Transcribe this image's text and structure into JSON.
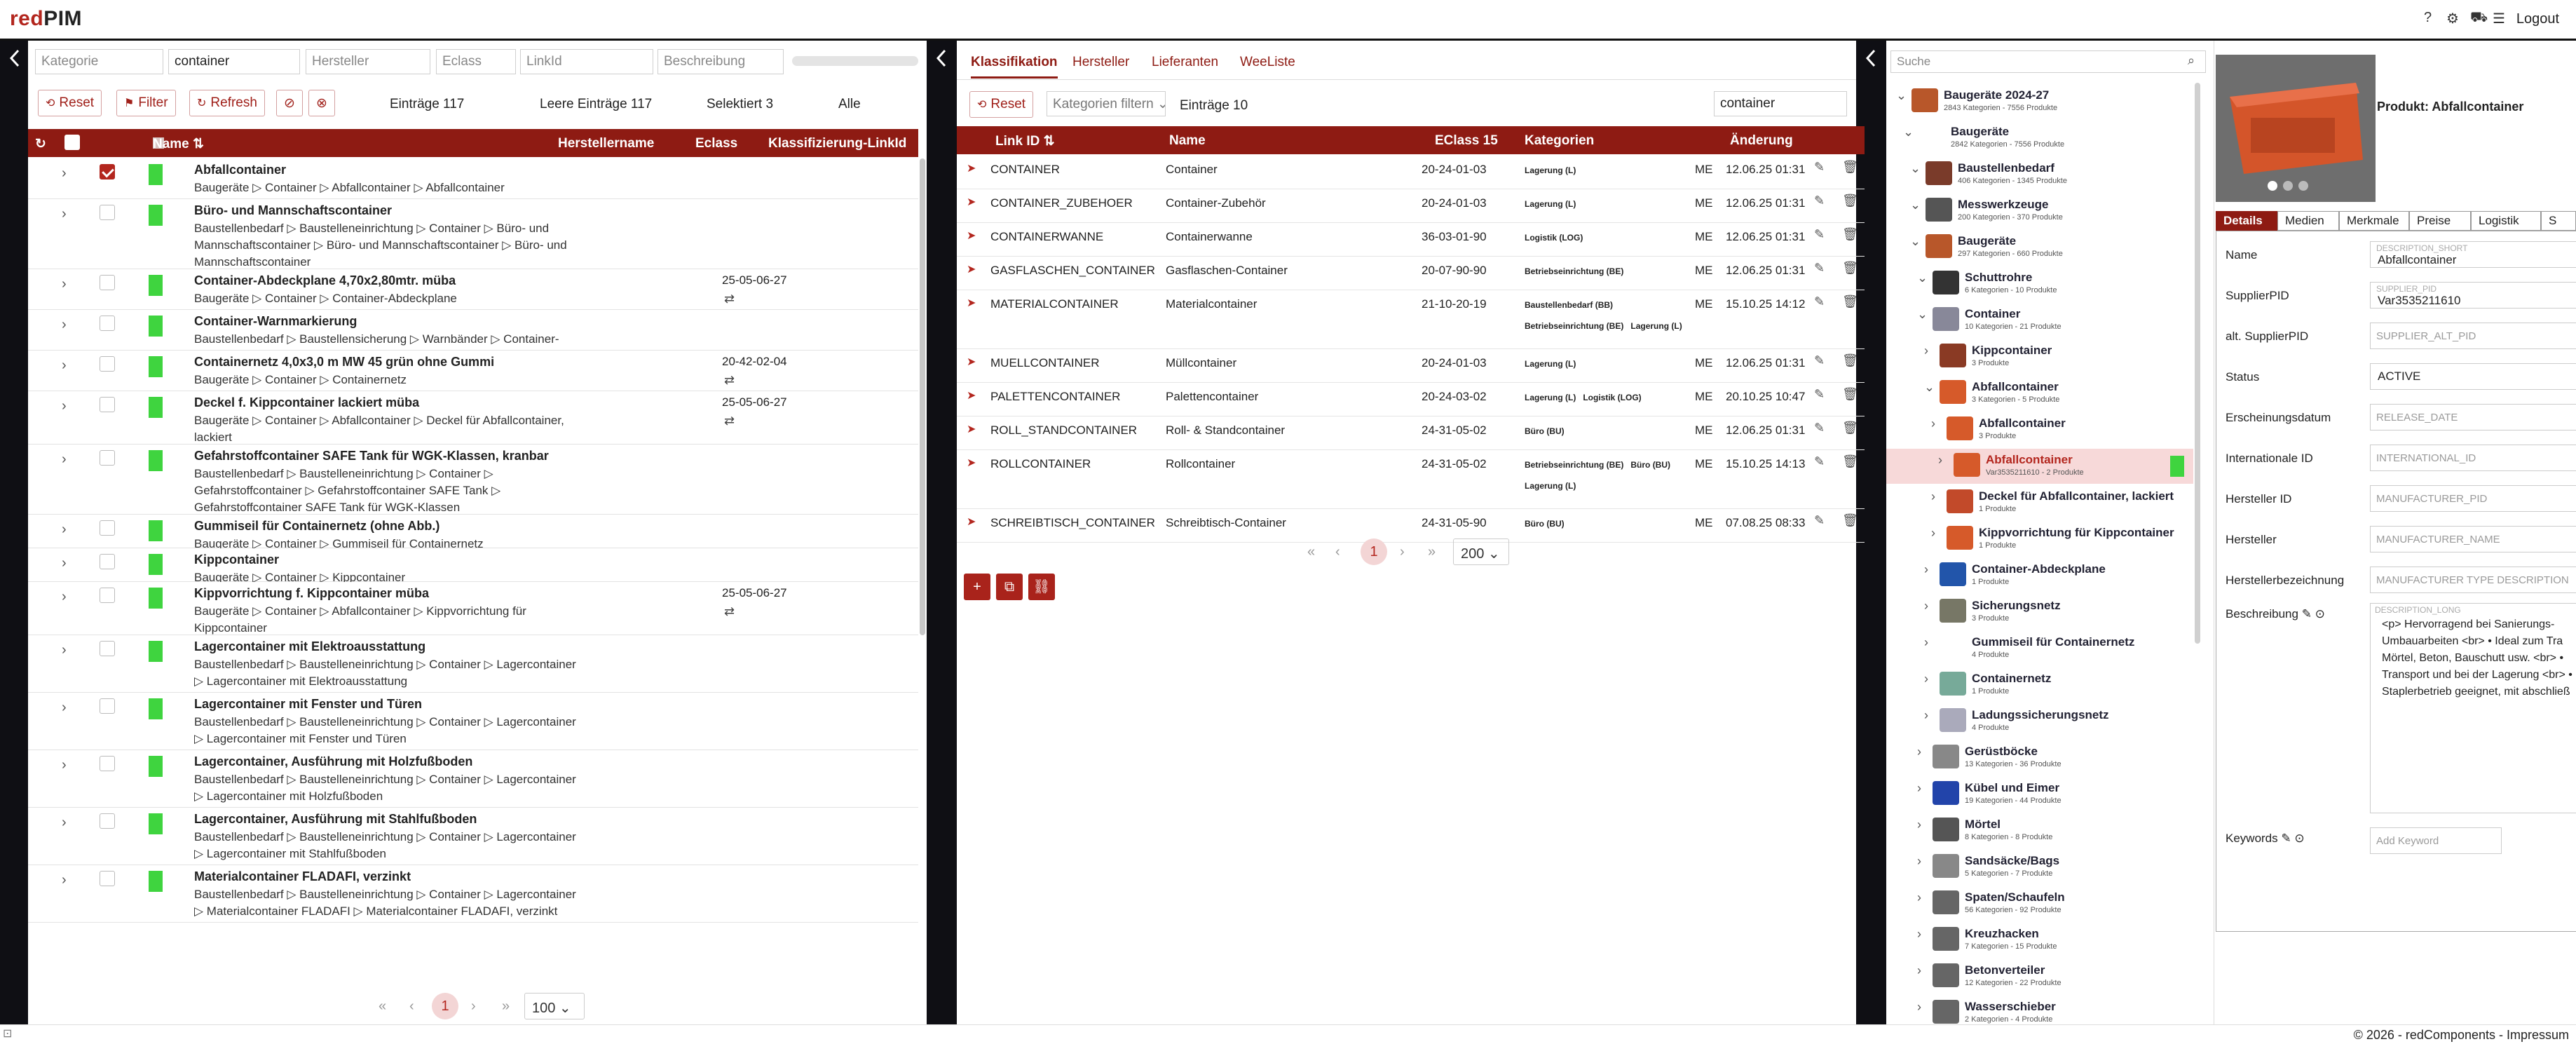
{
  "app": {
    "logo": "redPIM",
    "logo_red": "red",
    "logo_rest": "PIM",
    "logout": "Logout",
    "footer": "© 2026 - redComponents - Impressum"
  },
  "left": {
    "filters": [
      {
        "ph": "Kategorie"
      },
      {
        "val": "container"
      },
      {
        "ph": "Hersteller"
      },
      {
        "ph": "Eclass"
      },
      {
        "ph": "LinkId"
      },
      {
        "ph": "Beschreibung"
      }
    ],
    "buttons": {
      "reset": "Reset",
      "filter": "Filter",
      "refresh": "Refresh"
    },
    "stats": {
      "entries": "Einträge 117",
      "empty": "Leere Einträge 117",
      "selected": "Selektiert 3",
      "all": "Alle"
    },
    "headers": {
      "name": "Name ⇅",
      "manufacturer": "Herstellername",
      "eclass": "Eclass",
      "link": "Klassifizierung-LinkId"
    },
    "rows": [
      {
        "name": "Abfallcontainer",
        "path": "Baugeräte ▷ Container ▷ Abfallcontainer ▷ Abfallcontainer",
        "eclass": "",
        "checked": true
      },
      {
        "name": "Büro- und Mannschaftscontainer",
        "path": "Baustellenbedarf ▷ Baustelleneinrichtung ▷ Container ▷ Büro- und Mannschaftscontainer ▷ Büro- und Mannschaftscontainer ▷ Büro- und Mannschaftscontainer",
        "eclass": ""
      },
      {
        "name": "Container-Abdeckplane 4,70x2,80mtr. müba",
        "path": "Baugeräte ▷ Container ▷ Container-Abdeckplane",
        "eclass": "25-05-06-27"
      },
      {
        "name": "Container-Warnmarkierung",
        "path": "Baustellenbedarf ▷ Baustellensicherung ▷ Warnbänder ▷ Container-Warnmarkierung",
        "eclass": ""
      },
      {
        "name": "Containernetz 4,0x3,0 m MW 45 grün ohne Gummi",
        "path": "Baugeräte ▷ Container ▷ Containernetz",
        "eclass": "20-42-02-04"
      },
      {
        "name": "Deckel f. Kippcontainer lackiert müba",
        "path": "Baugeräte ▷ Container ▷ Abfallcontainer ▷ Deckel für Abfallcontainer, lackiert",
        "eclass": "25-05-06-27"
      },
      {
        "name": "Gefahrstoffcontainer SAFE Tank für WGK-Klassen, kranbar",
        "path": "Baustellenbedarf ▷ Baustelleneinrichtung ▷ Container ▷ Gefahrstoffcontainer ▷ Gefahrstoffcontainer SAFE Tank ▷ Gefahrstoffcontainer SAFE Tank für WGK-Klassen",
        "eclass": ""
      },
      {
        "name": "Gummiseil für Containernetz (ohne Abb.)",
        "path": "Baugeräte ▷ Container ▷ Gummiseil für Containernetz",
        "eclass": ""
      },
      {
        "name": "Kippcontainer",
        "path": "Baugeräte ▷ Container ▷ Kippcontainer",
        "eclass": ""
      },
      {
        "name": "Kippvorrichtung f. Kippcontainer müba",
        "path": "Baugeräte ▷ Container ▷ Abfallcontainer ▷ Kippvorrichtung für Kippcontainer",
        "eclass": "25-05-06-27"
      },
      {
        "name": "Lagercontainer mit Elektroausstattung",
        "path": "Baustellenbedarf ▷ Baustelleneinrichtung ▷ Container ▷ Lagercontainer ▷ Lagercontainer mit Elektroausstattung",
        "eclass": ""
      },
      {
        "name": "Lagercontainer mit Fenster und Türen",
        "path": "Baustellenbedarf ▷ Baustelleneinrichtung ▷ Container ▷ Lagercontainer ▷ Lagercontainer mit Fenster und Türen",
        "eclass": ""
      },
      {
        "name": "Lagercontainer, Ausführung mit Holzfußboden",
        "path": "Baustellenbedarf ▷ Baustelleneinrichtung ▷ Container ▷ Lagercontainer ▷ Lagercontainer mit Holzfußboden",
        "eclass": ""
      },
      {
        "name": "Lagercontainer, Ausführung mit Stahlfußboden",
        "path": "Baustellenbedarf ▷ Baustelleneinrichtung ▷ Container ▷ Lagercontainer ▷ Lagercontainer mit Stahlfußboden",
        "eclass": ""
      },
      {
        "name": "Materialcontainer FLADAFI, verzinkt",
        "path": "Baustellenbedarf ▷ Baustelleneinrichtung ▷ Container ▷ Lagercontainer ▷ Materialcontainer FLADAFI ▷ Materialcontainer FLADAFI, verzinkt",
        "eclass": ""
      }
    ],
    "pager": {
      "page": "1",
      "size": "100"
    }
  },
  "middle": {
    "tabs": [
      "Klassifikation",
      "Hersteller",
      "Lieferanten",
      "WeeListe"
    ],
    "reset": "Reset",
    "cat_filter": "Kategorien filtern",
    "entries": "Einträge 10",
    "search": "container",
    "headers": {
      "link": "Link ID ⇅",
      "name": "Name",
      "eclass": "EClass 15",
      "cats": "Kategorien",
      "change": "Änderung"
    },
    "rows": [
      {
        "id": "CONTAINER",
        "name": "Container",
        "ecl": "20-24-01-03",
        "cats": [
          "Lagerung (L)"
        ],
        "unit": "ME",
        "date": "12.06.25 01:31"
      },
      {
        "id": "CONTAINER_ZUBEHOER",
        "name": "Container-Zubehör",
        "ecl": "20-24-01-03",
        "cats": [
          "Lagerung (L)"
        ],
        "unit": "ME",
        "date": "12.06.25 01:31"
      },
      {
        "id": "CONTAINERWANNE",
        "name": "Containerwanne",
        "ecl": "36-03-01-90",
        "cats": [
          "Logistik (LOG)"
        ],
        "unit": "ME",
        "date": "12.06.25 01:31"
      },
      {
        "id": "GASFLASCHEN_CONTAINER",
        "name": "Gasflaschen-Container",
        "ecl": "20-07-90-90",
        "cats": [
          "Betriebseinrichtung (BE)"
        ],
        "unit": "ME",
        "date": "12.06.25 01:31"
      },
      {
        "id": "MATERIALCONTAINER",
        "name": "Materialcontainer",
        "ecl": "21-10-20-19",
        "cats": [
          "Baustellenbedarf (BB)",
          "Betriebseinrichtung (BE)",
          "Lagerung (L)"
        ],
        "unit": "ME",
        "date": "15.10.25 14:12"
      },
      {
        "id": "MUELLCONTAINER",
        "name": "Müllcontainer",
        "ecl": "20-24-01-03",
        "cats": [
          "Lagerung (L)"
        ],
        "unit": "ME",
        "date": "12.06.25 01:31"
      },
      {
        "id": "PALETTENCONTAINER",
        "name": "Palettencontainer",
        "ecl": "20-24-03-02",
        "cats": [
          "Lagerung (L)",
          "Logistik (LOG)"
        ],
        "unit": "ME",
        "date": "20.10.25 10:47"
      },
      {
        "id": "ROLL_STANDCONTAINER",
        "name": "Roll- & Standcontainer",
        "ecl": "24-31-05-02",
        "cats": [
          "Büro (BU)"
        ],
        "unit": "ME",
        "date": "12.06.25 01:31"
      },
      {
        "id": "ROLLCONTAINER",
        "name": "Rollcontainer",
        "ecl": "24-31-05-02",
        "cats": [
          "Betriebseinrichtung (BE)",
          "Büro (BU)",
          "Lagerung (L)"
        ],
        "unit": "ME",
        "date": "15.10.25 14:13"
      },
      {
        "id": "SCHREIBTISCH_CONTAINER",
        "name": "Schreibtisch-Container",
        "ecl": "24-31-05-90",
        "cats": [
          "Büro (BU)"
        ],
        "unit": "ME",
        "date": "07.08.25 08:33"
      }
    ],
    "pager": {
      "page": "1",
      "size": "200"
    }
  },
  "tree": {
    "search_ph": "Suche",
    "nodes": [
      {
        "label": "Baugeräte 2024-27",
        "sub": "2843 Kategorien - 7556 Produkte",
        "lvl": 0,
        "color": "#b8572a"
      },
      {
        "label": "Baugeräte",
        "sub": "2842 Kategorien - 7556 Produkte",
        "lvl": 1,
        "color": ""
      },
      {
        "label": "Baustellenbedarf",
        "sub": "406 Kategorien - 1345 Produkte",
        "lvl": 2,
        "color": "#7a3b2a"
      },
      {
        "label": "Messwerkzeuge",
        "sub": "200 Kategorien - 370 Produkte",
        "lvl": 2,
        "color": "#555"
      },
      {
        "label": "Baugeräte",
        "sub": "297 Kategorien - 660 Produkte",
        "lvl": 2,
        "color": "#b8572a"
      },
      {
        "label": "Schuttrohre",
        "sub": "6 Kategorien - 10 Produkte",
        "lvl": 3,
        "color": "#333"
      },
      {
        "label": "Container",
        "sub": "10 Kategorien - 21 Produkte",
        "lvl": 3,
        "color": "#889"
      },
      {
        "label": "Kippcontainer",
        "sub": "3 Produkte",
        "lvl": 4,
        "color": "#8a3a24"
      },
      {
        "label": "Abfallcontainer",
        "sub": "3 Kategorien - 5 Produkte",
        "lvl": 4,
        "color": "#d65a2a"
      },
      {
        "label": "Abfallcontainer",
        "sub": "3 Produkte",
        "lvl": 5,
        "color": "#d65a2a"
      },
      {
        "label": "Abfallcontainer",
        "sub": "Var3535211610 - 2 Produkte",
        "lvl": 6,
        "color": "#d65a2a",
        "hl": true
      },
      {
        "label": "Deckel für Abfallcontainer, lackiert",
        "sub": "1 Produkte",
        "lvl": 5,
        "color": "#c24a2a"
      },
      {
        "label": "Kippvorrichtung für Kippcontainer",
        "sub": "1 Produkte",
        "lvl": 5,
        "color": "#d65a2a"
      },
      {
        "label": "Container-Abdeckplane",
        "sub": "1 Produkte",
        "lvl": 4,
        "color": "#2255aa"
      },
      {
        "label": "Sicherungsnetz",
        "sub": "3 Produkte",
        "lvl": 4,
        "color": "#776"
      },
      {
        "label": "Gummiseil für Containernetz",
        "sub": "4 Produkte",
        "lvl": 4,
        "color": ""
      },
      {
        "label": "Containernetz",
        "sub": "1 Produkte",
        "lvl": 4,
        "color": "#7a9"
      },
      {
        "label": "Ladungssicherungsnetz",
        "sub": "4 Produkte",
        "lvl": 4,
        "color": "#aab"
      },
      {
        "label": "Gerüstböcke",
        "sub": "13 Kategorien - 36 Produkte",
        "lvl": 3,
        "color": "#888"
      },
      {
        "label": "Kübel und Eimer",
        "sub": "19 Kategorien - 44 Produkte",
        "lvl": 3,
        "color": "#2244aa"
      },
      {
        "label": "Mörtel",
        "sub": "8 Kategorien - 8 Produkte",
        "lvl": 3,
        "color": "#555"
      },
      {
        "label": "Sandsäcke/Bags",
        "sub": "5 Kategorien - 7 Produkte",
        "lvl": 3,
        "color": "#888"
      },
      {
        "label": "Spaten/Schaufeln",
        "sub": "56 Kategorien - 92 Produkte",
        "lvl": 3,
        "color": "#666"
      },
      {
        "label": "Kreuzhacken",
        "sub": "7 Kategorien - 15 Produkte",
        "lvl": 3,
        "color": "#666"
      },
      {
        "label": "Betonverteiler",
        "sub": "12 Kategorien - 22 Produkte",
        "lvl": 3,
        "color": "#666"
      },
      {
        "label": "Wasserschieber",
        "sub": "2 Kategorien - 4 Produkte",
        "lvl": 3,
        "color": "#666"
      }
    ]
  },
  "detail": {
    "title": "Produkt: Abfallcontainer",
    "tabs": [
      "Details",
      "Medien",
      "Merkmale",
      "Preise",
      "Logistik",
      "S"
    ],
    "fields": [
      {
        "label": "Name",
        "ph": "DESCRIPTION_SHORT",
        "val": "Abfallcontainer"
      },
      {
        "label": "SupplierPID",
        "ph": "SUPPLIER_PID",
        "val": "Var3535211610"
      },
      {
        "label": "alt. SupplierPID",
        "ph": "",
        "val": "",
        "ph2": "SUPPLIER_ALT_PID"
      },
      {
        "label": "Status",
        "ph": "",
        "val": "ACTIVE"
      },
      {
        "label": "Erscheinungsdatum",
        "ph": "",
        "val": "",
        "ph2": "RELEASE_DATE"
      },
      {
        "label": "Internationale ID",
        "ph": "",
        "val": "",
        "ph2": "INTERNATIONAL_ID"
      },
      {
        "label": "Hersteller ID",
        "ph": "",
        "val": "",
        "ph2": "MANUFACTURER_PID"
      },
      {
        "label": "Hersteller",
        "ph": "",
        "val": "",
        "ph2": "MANUFACTURER_NAME"
      },
      {
        "label": "Herstellerbezeichnung",
        "ph": "",
        "val": "",
        "ph2": "MANUFACTURER TYPE DESCRIPTION"
      }
    ],
    "desc_label": "Beschreibung",
    "desc_ph": "DESCRIPTION_LONG",
    "desc_lines": [
      "<p>      Hervorragend bei Sanierungs-",
      "Umbauarbeiten <br> •    Ideal zum Tra",
      "Mörtel, Beton, Bauschutt usw. <br> •",
      "Transport und bei der Lagerung <br> •",
      "Staplerbetrieb geeignet, mit abschließ"
    ],
    "keywords_label": "Keywords",
    "keyword_ph": "Add Keyword"
  }
}
